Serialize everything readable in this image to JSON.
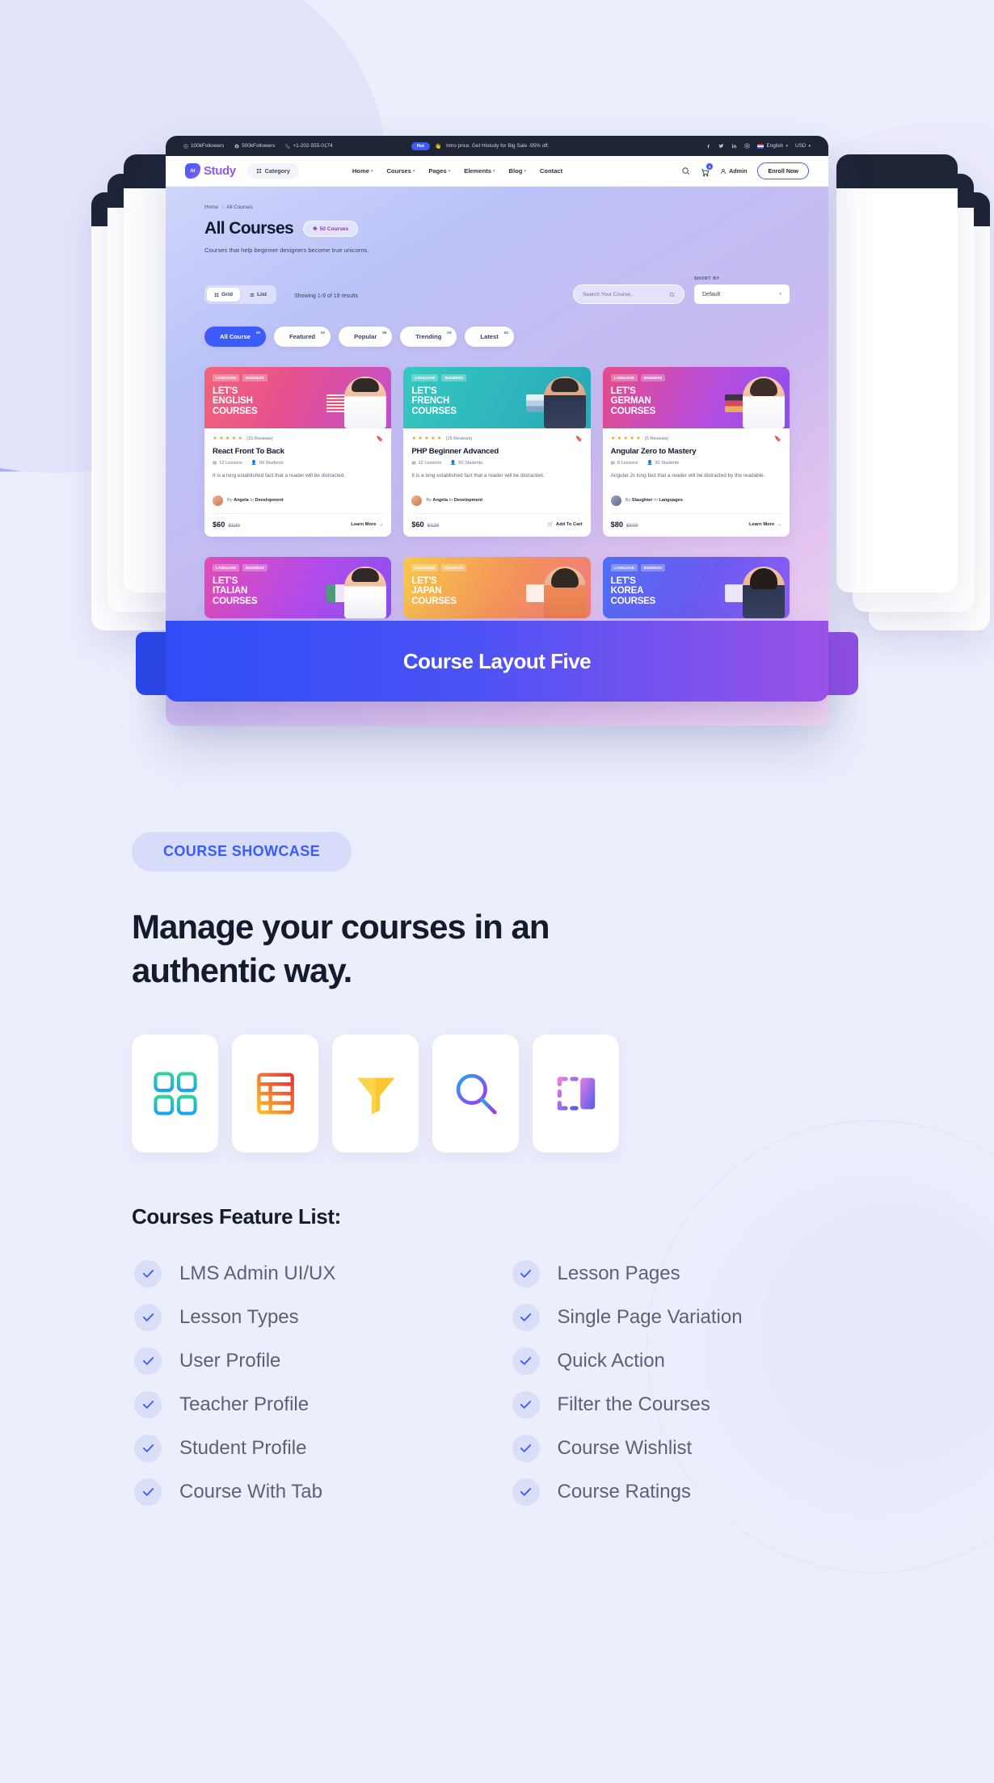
{
  "mockup": {
    "topbar": {
      "followers_1": "100kFollowers",
      "followers_2": "500kFollowers",
      "phone": "+1-202-555-0174",
      "hot_badge": "Hot",
      "promo": "Intro price. Get Histudy for Big Sale -95% off.",
      "language": "English",
      "currency": "USD"
    },
    "navbar": {
      "logo": "Study",
      "logo_mark": "hi",
      "category_label": "Category",
      "links": [
        "Home",
        "Courses",
        "Pages",
        "Elements",
        "Blog",
        "Contact"
      ],
      "cart_count": "0",
      "account": "Admin",
      "enroll": "Enroll Now"
    },
    "page": {
      "breadcrumb_home": "Home",
      "breadcrumb_current": "All Courses",
      "title": "All Courses",
      "count_badge": "50 Courses",
      "subtitle": "Courses that help beginner designers become true unicorns.",
      "view_grid": "Grid",
      "view_list": "List",
      "showing": "Showing 1-9 of 19 results",
      "search_placeholder": "Search Your Course..",
      "sort_label": "SHORT BY",
      "sort_value": "Default",
      "chips": [
        {
          "label": "All Course",
          "count": "06",
          "active": true
        },
        {
          "label": "Featured",
          "count": "02",
          "active": false
        },
        {
          "label": "Popular",
          "count": "05",
          "active": false
        },
        {
          "label": "Trending",
          "count": "03",
          "active": false
        },
        {
          "label": "Latest",
          "count": "04",
          "active": false
        }
      ],
      "cards": [
        {
          "banner_tag_1": "LANGUAGE",
          "banner_tag_2": "BUSINESS",
          "banner_title_1": "LET'S",
          "banner_title_2": "ENGLISH",
          "banner_title_3": "COURSES",
          "reviews": "(15 Reviews)",
          "title": "React Front To Back",
          "lessons": "12 Lessons",
          "students": "50 Students",
          "desc": "It is a long established fact that a reader will be distracted.",
          "author": "Angela",
          "category": "Development",
          "price": "$60",
          "old_price": "$120",
          "cta": "Learn More"
        },
        {
          "banner_tag_1": "LANGUAGE",
          "banner_tag_2": "BUSINESS",
          "banner_title_1": "LET'S",
          "banner_title_2": "FRENCH",
          "banner_title_3": "COURSES",
          "reviews": "(15 Reviews)",
          "title": "PHP Beginner Advanced",
          "lessons": "12 Lessons",
          "students": "50 Students",
          "desc": "It is a long established fact that a reader will be distracted.",
          "author": "Angela",
          "category": "Development",
          "price": "$60",
          "old_price": "$120",
          "cta": "Add To Cart"
        },
        {
          "banner_tag_1": "LANGUAGE",
          "banner_tag_2": "BUSINESS",
          "banner_title_1": "LET'S",
          "banner_title_2": "GERMAN",
          "banner_title_3": "COURSES",
          "reviews": "(5 Reviews)",
          "title": "Angular Zero to Mastery",
          "lessons": "8 Lessons",
          "students": "30 Students",
          "desc": "Angular Js long fact that a reader will be distracted by the readable.",
          "author": "Slaughter",
          "category": "Languages",
          "price": "$80",
          "old_price": "$100",
          "cta": "Learn More"
        }
      ],
      "cards_row2": [
        {
          "banner_title_1": "LET'S",
          "banner_title_2": "ITALIAN",
          "banner_title_3": "COURSES"
        },
        {
          "banner_title_1": "LET'S",
          "banner_title_2": "JAPAN",
          "banner_title_3": "COURSES"
        },
        {
          "banner_title_1": "LET'S",
          "banner_title_2": "KOREA",
          "banner_title_3": "COURSES"
        }
      ]
    },
    "banner_caption": "Course Layout Five"
  },
  "showcase": {
    "eyebrow": "COURSE SHOWCASE",
    "headline": "Manage your courses in an authentic way.",
    "icons": [
      {
        "name": "grid-view-icon"
      },
      {
        "name": "table-list-icon"
      },
      {
        "name": "filter-funnel-icon"
      },
      {
        "name": "magnifier-search-icon"
      },
      {
        "name": "layout-panel-icon"
      }
    ],
    "feature_heading": "Courses Feature List:",
    "features": [
      "LMS Admin UI/UX",
      "Lesson Pages",
      "Lesson Types",
      "Single Page Variation",
      "User Profile",
      "Quick Action",
      "Teacher Profile",
      "Filter the Courses",
      "Student Profile",
      "Course Wishlist",
      "Course With Tab",
      "Course Ratings"
    ]
  },
  "colors": {
    "accent": "#3b5bfd",
    "dark": "#1d2436",
    "page_bg": "#eceefc",
    "badge_bg": "#d7dcfb"
  }
}
